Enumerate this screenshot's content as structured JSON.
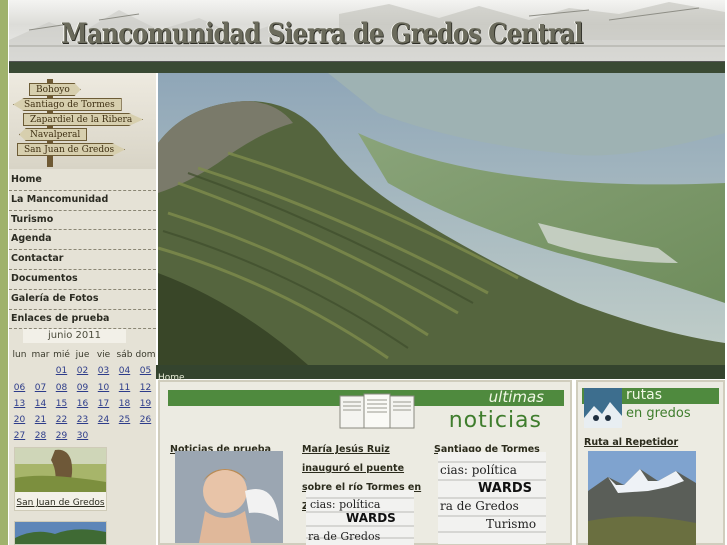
{
  "site": {
    "title": "Mancomunidad Sierra de Gredos Central"
  },
  "signpost": [
    "Bohoyo",
    "Santiago de Tormes",
    "Zapardiel de la Ribera",
    "Navalperal",
    "San Juan de Gredos"
  ],
  "nav": [
    "Home",
    "La Mancomunidad",
    "Turismo",
    "Agenda",
    "Contactar",
    "Documentos",
    "Galería de Fotos",
    "Enlaces de prueba"
  ],
  "calendar": {
    "month": "junio 2011",
    "weekdays": [
      "lun",
      "mar",
      "mié",
      "jue",
      "vie",
      "sáb",
      "dom"
    ],
    "weeks": [
      [
        "",
        "",
        "01",
        "02",
        "03",
        "04",
        "05"
      ],
      [
        "06",
        "07",
        "08",
        "09",
        "10",
        "11",
        "12"
      ],
      [
        "13",
        "14",
        "15",
        "16",
        "17",
        "18",
        "19"
      ],
      [
        "20",
        "21",
        "22",
        "23",
        "24",
        "25",
        "26"
      ],
      [
        "27",
        "28",
        "29",
        "30",
        "",
        "",
        ""
      ]
    ]
  },
  "sidebar_thumbs": [
    {
      "caption": "San Juan de Gredos"
    }
  ],
  "breadcrumb": "Home",
  "news": {
    "heading_top": "ultimas",
    "heading_bottom": "noticias",
    "items": [
      {
        "title": "Noticias de prueba"
      },
      {
        "title": "María Jesús Ruiz inauguró el puente sobre el río Tormes en Zapardiel"
      },
      {
        "title": "Santiago de Tormes"
      }
    ]
  },
  "rutas": {
    "heading_top": "rutas",
    "heading_bottom": "en gredos",
    "link": "Ruta al Repetidor"
  },
  "colors": {
    "accent_green": "#4f8a3e",
    "dark_green": "#3a4a34",
    "sidebar_bg": "#e5e2d6"
  }
}
